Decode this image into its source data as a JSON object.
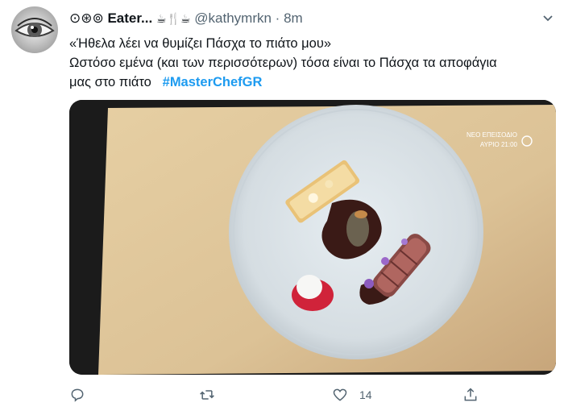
{
  "tweet": {
    "display_name": "Eater...",
    "name_prefix_icon": "circled-symbols-icon",
    "name_emojis": [
      "hot-beverage-icon",
      "fork-knife-icon",
      "hot-beverage-icon"
    ],
    "handle": "@kathymrkn",
    "separator": "·",
    "time": "8m",
    "line1": "«Ήθελα λέει να θυμίζει Πάσχα το πιάτο μου»",
    "line2": "Ωστόσο εμένα (και των περισσότερων) τόσα είναι το Πάσχα τα αποφάγια",
    "line3": "μας στο πιάτο",
    "hashtag": "#MasterChefGR",
    "media": {
      "overlay_line1": "ΝΕΟ ΕΠΕΙΣΟΔΙΟ",
      "overlay_line2": "ΑΥΡΙΟ 21:00",
      "description_icon": "tv-screen-plated-dish"
    },
    "actions": {
      "reply_icon": "reply-icon",
      "retweet_icon": "retweet-icon",
      "like_icon": "heart-icon",
      "like_count": "14",
      "share_icon": "share-icon"
    }
  },
  "colors": {
    "text": "#0f1419",
    "secondary": "#536471",
    "link": "#1d9bf0"
  }
}
